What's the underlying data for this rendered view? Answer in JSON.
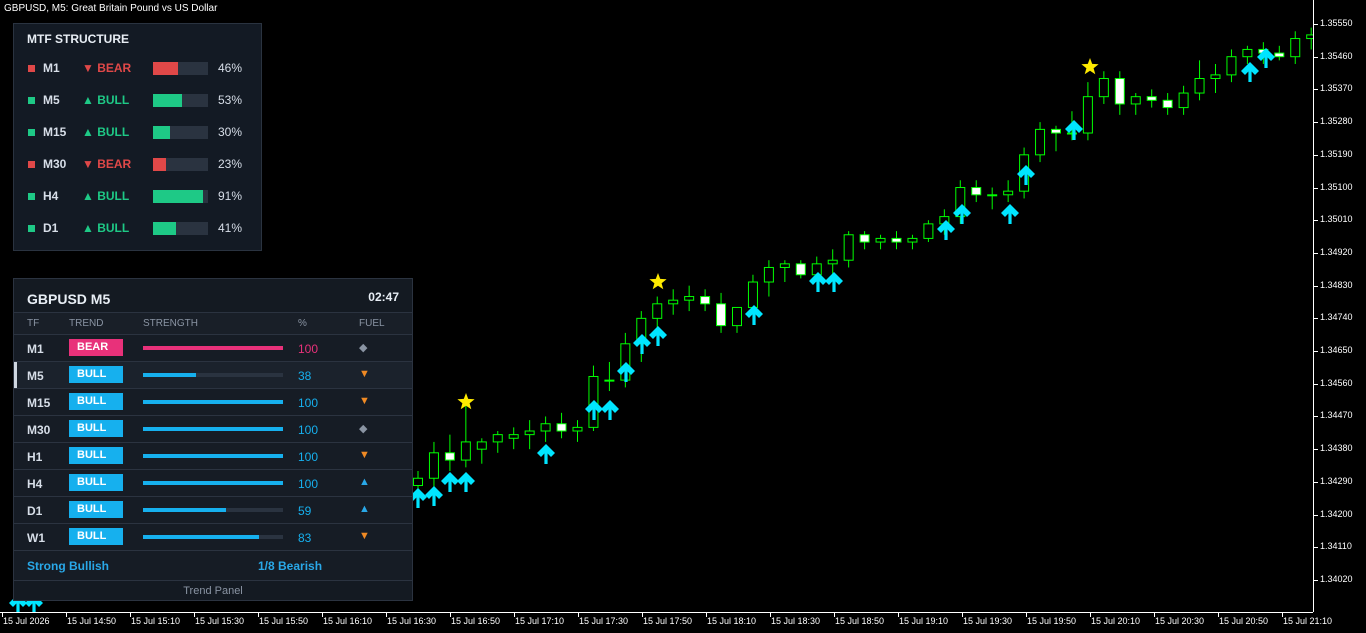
{
  "chart_title": "GBPUSD, M5:  Great Britain Pound vs US Dollar",
  "price_labels": [
    "1.35550",
    "1.35460",
    "1.35370",
    "1.35280",
    "1.35190",
    "1.35100",
    "1.35010",
    "1.34920",
    "1.34830",
    "1.34740",
    "1.34650",
    "1.34560",
    "1.34470",
    "1.34380",
    "1.34290",
    "1.34200",
    "1.34110",
    "1.34020"
  ],
  "time_labels": [
    "15 Jul 2026",
    "15 Jul 14:50",
    "15 Jul 15:10",
    "15 Jul 15:30",
    "15 Jul 15:50",
    "15 Jul 16:10",
    "15 Jul 16:30",
    "15 Jul 16:50",
    "15 Jul 17:10",
    "15 Jul 17:30",
    "15 Jul 17:50",
    "15 Jul 18:10",
    "15 Jul 18:30",
    "15 Jul 18:50",
    "15 Jul 19:10",
    "15 Jul 19:30",
    "15 Jul 19:50",
    "15 Jul 20:10",
    "15 Jul 20:30",
    "15 Jul 20:50",
    "15 Jul 21:10"
  ],
  "colors": {
    "bull_candle": "#00ff00",
    "bear_candle": "#ffffff",
    "arrow": "#00e5ff",
    "star": "#ffea00",
    "bull": "#1ec986",
    "bear": "#e04848",
    "panel_bull": "#16b0ee",
    "panel_bear": "#e8317a",
    "fuel_orange": "#f08a24",
    "fuel_gray": "#8a94a3",
    "fuel_blue": "#29a8e8"
  },
  "mtf": {
    "title": "MTF STRUCTURE",
    "rows": [
      {
        "tf": "M1",
        "dir": "▼ BEAR",
        "pct": "46%",
        "value": 46,
        "state": "bear"
      },
      {
        "tf": "M5",
        "dir": "▲ BULL",
        "pct": "53%",
        "value": 53,
        "state": "bull"
      },
      {
        "tf": "M15",
        "dir": "▲ BULL",
        "pct": "30%",
        "value": 30,
        "state": "bull"
      },
      {
        "tf": "M30",
        "dir": "▼ BEAR",
        "pct": "23%",
        "value": 23,
        "state": "bear"
      },
      {
        "tf": "H4",
        "dir": "▲ BULL",
        "pct": "91%",
        "value": 91,
        "state": "bull"
      },
      {
        "tf": "D1",
        "dir": "▲ BULL",
        "pct": "41%",
        "value": 41,
        "state": "bull"
      }
    ]
  },
  "trend_panel": {
    "symbol": "GBPUSD  M5",
    "time": "02:47",
    "columns": {
      "tf": "TF",
      "trend": "TREND",
      "strength": "STRENGTH",
      "pct": "%",
      "fuel": "FUEL"
    },
    "rows": [
      {
        "tf": "M1",
        "trend": "BEAR",
        "strength": 100,
        "pct": "100",
        "fuel": "◆",
        "fuel_color": "gray",
        "state": "bear"
      },
      {
        "tf": "M5",
        "trend": "BULL",
        "strength": 38,
        "pct": "38",
        "fuel": "▼",
        "fuel_color": "orange",
        "state": "bull",
        "active": true
      },
      {
        "tf": "M15",
        "trend": "BULL",
        "strength": 100,
        "pct": "100",
        "fuel": "▼",
        "fuel_color": "orange",
        "state": "bull"
      },
      {
        "tf": "M30",
        "trend": "BULL",
        "strength": 100,
        "pct": "100",
        "fuel": "◆",
        "fuel_color": "gray",
        "state": "bull"
      },
      {
        "tf": "H1",
        "trend": "BULL",
        "strength": 100,
        "pct": "100",
        "fuel": "▼",
        "fuel_color": "orange",
        "state": "bull"
      },
      {
        "tf": "H4",
        "trend": "BULL",
        "strength": 100,
        "pct": "100",
        "fuel": "▲",
        "fuel_color": "blue",
        "state": "bull"
      },
      {
        "tf": "D1",
        "trend": "BULL",
        "strength": 59,
        "pct": "59",
        "fuel": "▲",
        "fuel_color": "blue",
        "state": "bull"
      },
      {
        "tf": "W1",
        "trend": "BULL",
        "strength": 83,
        "pct": "83",
        "fuel": "▼",
        "fuel_color": "orange",
        "state": "bull"
      }
    ],
    "footer_left": "Strong Bullish",
    "footer_right": "1/8 Bearish",
    "caption": "Trend Panel"
  },
  "chart_data": {
    "type": "candlestick",
    "symbol": "GBPUSD",
    "timeframe": "M5",
    "ylim": [
      1.3396,
      1.3561
    ],
    "candles": [
      [
        1.3428,
        1.3432,
        1.3423,
        1.343
      ],
      [
        1.343,
        1.344,
        1.3427,
        1.3437
      ],
      [
        1.3437,
        1.3442,
        1.3432,
        1.3435
      ],
      [
        1.3435,
        1.345,
        1.3433,
        1.344
      ],
      [
        1.3438,
        1.3441,
        1.3434,
        1.344
      ],
      [
        1.344,
        1.3443,
        1.3437,
        1.3442
      ],
      [
        1.3441,
        1.3444,
        1.3438,
        1.3442
      ],
      [
        1.3442,
        1.3446,
        1.3438,
        1.3443
      ],
      [
        1.3443,
        1.3447,
        1.344,
        1.3445
      ],
      [
        1.3445,
        1.3448,
        1.3441,
        1.3443
      ],
      [
        1.3443,
        1.3446,
        1.344,
        1.3444
      ],
      [
        1.3444,
        1.3461,
        1.3443,
        1.3458
      ],
      [
        1.3457,
        1.3462,
        1.3454,
        1.3457
      ],
      [
        1.3457,
        1.347,
        1.3455,
        1.3467
      ],
      [
        1.3467,
        1.3476,
        1.3462,
        1.3474
      ],
      [
        1.3474,
        1.348,
        1.3471,
        1.3478
      ],
      [
        1.3478,
        1.3482,
        1.3475,
        1.3479
      ],
      [
        1.3479,
        1.3483,
        1.3476,
        1.348
      ],
      [
        1.348,
        1.3482,
        1.3476,
        1.3478
      ],
      [
        1.3478,
        1.3481,
        1.347,
        1.3472
      ],
      [
        1.3472,
        1.3477,
        1.347,
        1.3477
      ],
      [
        1.3477,
        1.3486,
        1.3476,
        1.3484
      ],
      [
        1.3484,
        1.349,
        1.348,
        1.3488
      ],
      [
        1.3488,
        1.349,
        1.3484,
        1.3489
      ],
      [
        1.3489,
        1.349,
        1.3485,
        1.3486
      ],
      [
        1.3486,
        1.3491,
        1.3484,
        1.3489
      ],
      [
        1.3489,
        1.3493,
        1.3485,
        1.349
      ],
      [
        1.349,
        1.3498,
        1.3488,
        1.3497
      ],
      [
        1.3497,
        1.3498,
        1.3493,
        1.3495
      ],
      [
        1.3495,
        1.3497,
        1.3493,
        1.3496
      ],
      [
        1.3496,
        1.3498,
        1.3493,
        1.3495
      ],
      [
        1.3495,
        1.3497,
        1.3493,
        1.3496
      ],
      [
        1.3496,
        1.3501,
        1.3495,
        1.35
      ],
      [
        1.35,
        1.3504,
        1.3497,
        1.3502
      ],
      [
        1.3502,
        1.3512,
        1.35,
        1.351
      ],
      [
        1.351,
        1.3512,
        1.3506,
        1.3508
      ],
      [
        1.3508,
        1.351,
        1.3504,
        1.3508
      ],
      [
        1.3508,
        1.3512,
        1.3506,
        1.3509
      ],
      [
        1.3509,
        1.3521,
        1.3507,
        1.3519
      ],
      [
        1.3519,
        1.3528,
        1.3517,
        1.3526
      ],
      [
        1.3526,
        1.3527,
        1.352,
        1.3525
      ],
      [
        1.3525,
        1.3531,
        1.3523,
        1.3525
      ],
      [
        1.3525,
        1.3539,
        1.3523,
        1.3535
      ],
      [
        1.3535,
        1.3542,
        1.3533,
        1.354
      ],
      [
        1.354,
        1.3542,
        1.353,
        1.3533
      ],
      [
        1.3533,
        1.3536,
        1.353,
        1.3535
      ],
      [
        1.3535,
        1.3537,
        1.3532,
        1.3534
      ],
      [
        1.3534,
        1.3536,
        1.353,
        1.3532
      ],
      [
        1.3532,
        1.3538,
        1.353,
        1.3536
      ],
      [
        1.3536,
        1.3545,
        1.3534,
        1.354
      ],
      [
        1.354,
        1.3544,
        1.3536,
        1.3541
      ],
      [
        1.3541,
        1.3548,
        1.3539,
        1.3546
      ],
      [
        1.3546,
        1.3549,
        1.3544,
        1.3548
      ],
      [
        1.3548,
        1.355,
        1.3544,
        1.3547
      ],
      [
        1.3547,
        1.3549,
        1.3545,
        1.3546
      ],
      [
        1.3546,
        1.3553,
        1.3544,
        1.3551
      ],
      [
        1.3551,
        1.3554,
        1.3548,
        1.3552
      ],
      [
        1.3552,
        1.3554,
        1.3549,
        1.3551
      ],
      [
        1.3551,
        1.356,
        1.3548,
        1.3558
      ]
    ]
  }
}
